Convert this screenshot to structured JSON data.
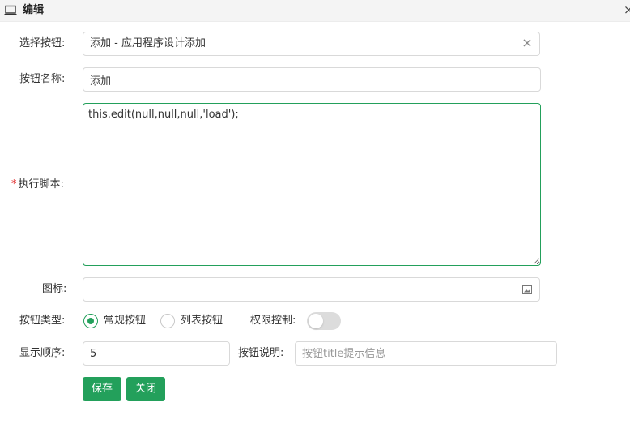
{
  "dialog": {
    "title": "编辑",
    "close_glyph": "×",
    "icon": "laptop-icon"
  },
  "form": {
    "select_button": {
      "label": "选择按钮:",
      "value": "添加 - 应用程序设计添加",
      "clear_glyph": "×"
    },
    "button_name": {
      "label": "按钮名称:",
      "value": "添加"
    },
    "script": {
      "required_mark": "*",
      "label": "执行脚本:",
      "value": "this.edit(null,null,null,'load');"
    },
    "icon_field": {
      "label": "图标:",
      "value": "",
      "icon": "image-icon"
    },
    "button_type": {
      "label": "按钮类型:",
      "options": [
        {
          "label": "常规按钮",
          "selected": true
        },
        {
          "label": "列表按钮",
          "selected": false
        }
      ]
    },
    "permission": {
      "label": "权限控制:",
      "enabled": false
    },
    "order": {
      "label": "显示顺序:",
      "value": "5"
    },
    "description": {
      "label": "按钮说明:",
      "value": "",
      "placeholder": "按钮title提示信息"
    }
  },
  "actions": {
    "save_label": "保存",
    "close_label": "关闭"
  },
  "colors": {
    "accent": "#23a05b",
    "required": "#e02424",
    "border": "#d9d9d9"
  }
}
